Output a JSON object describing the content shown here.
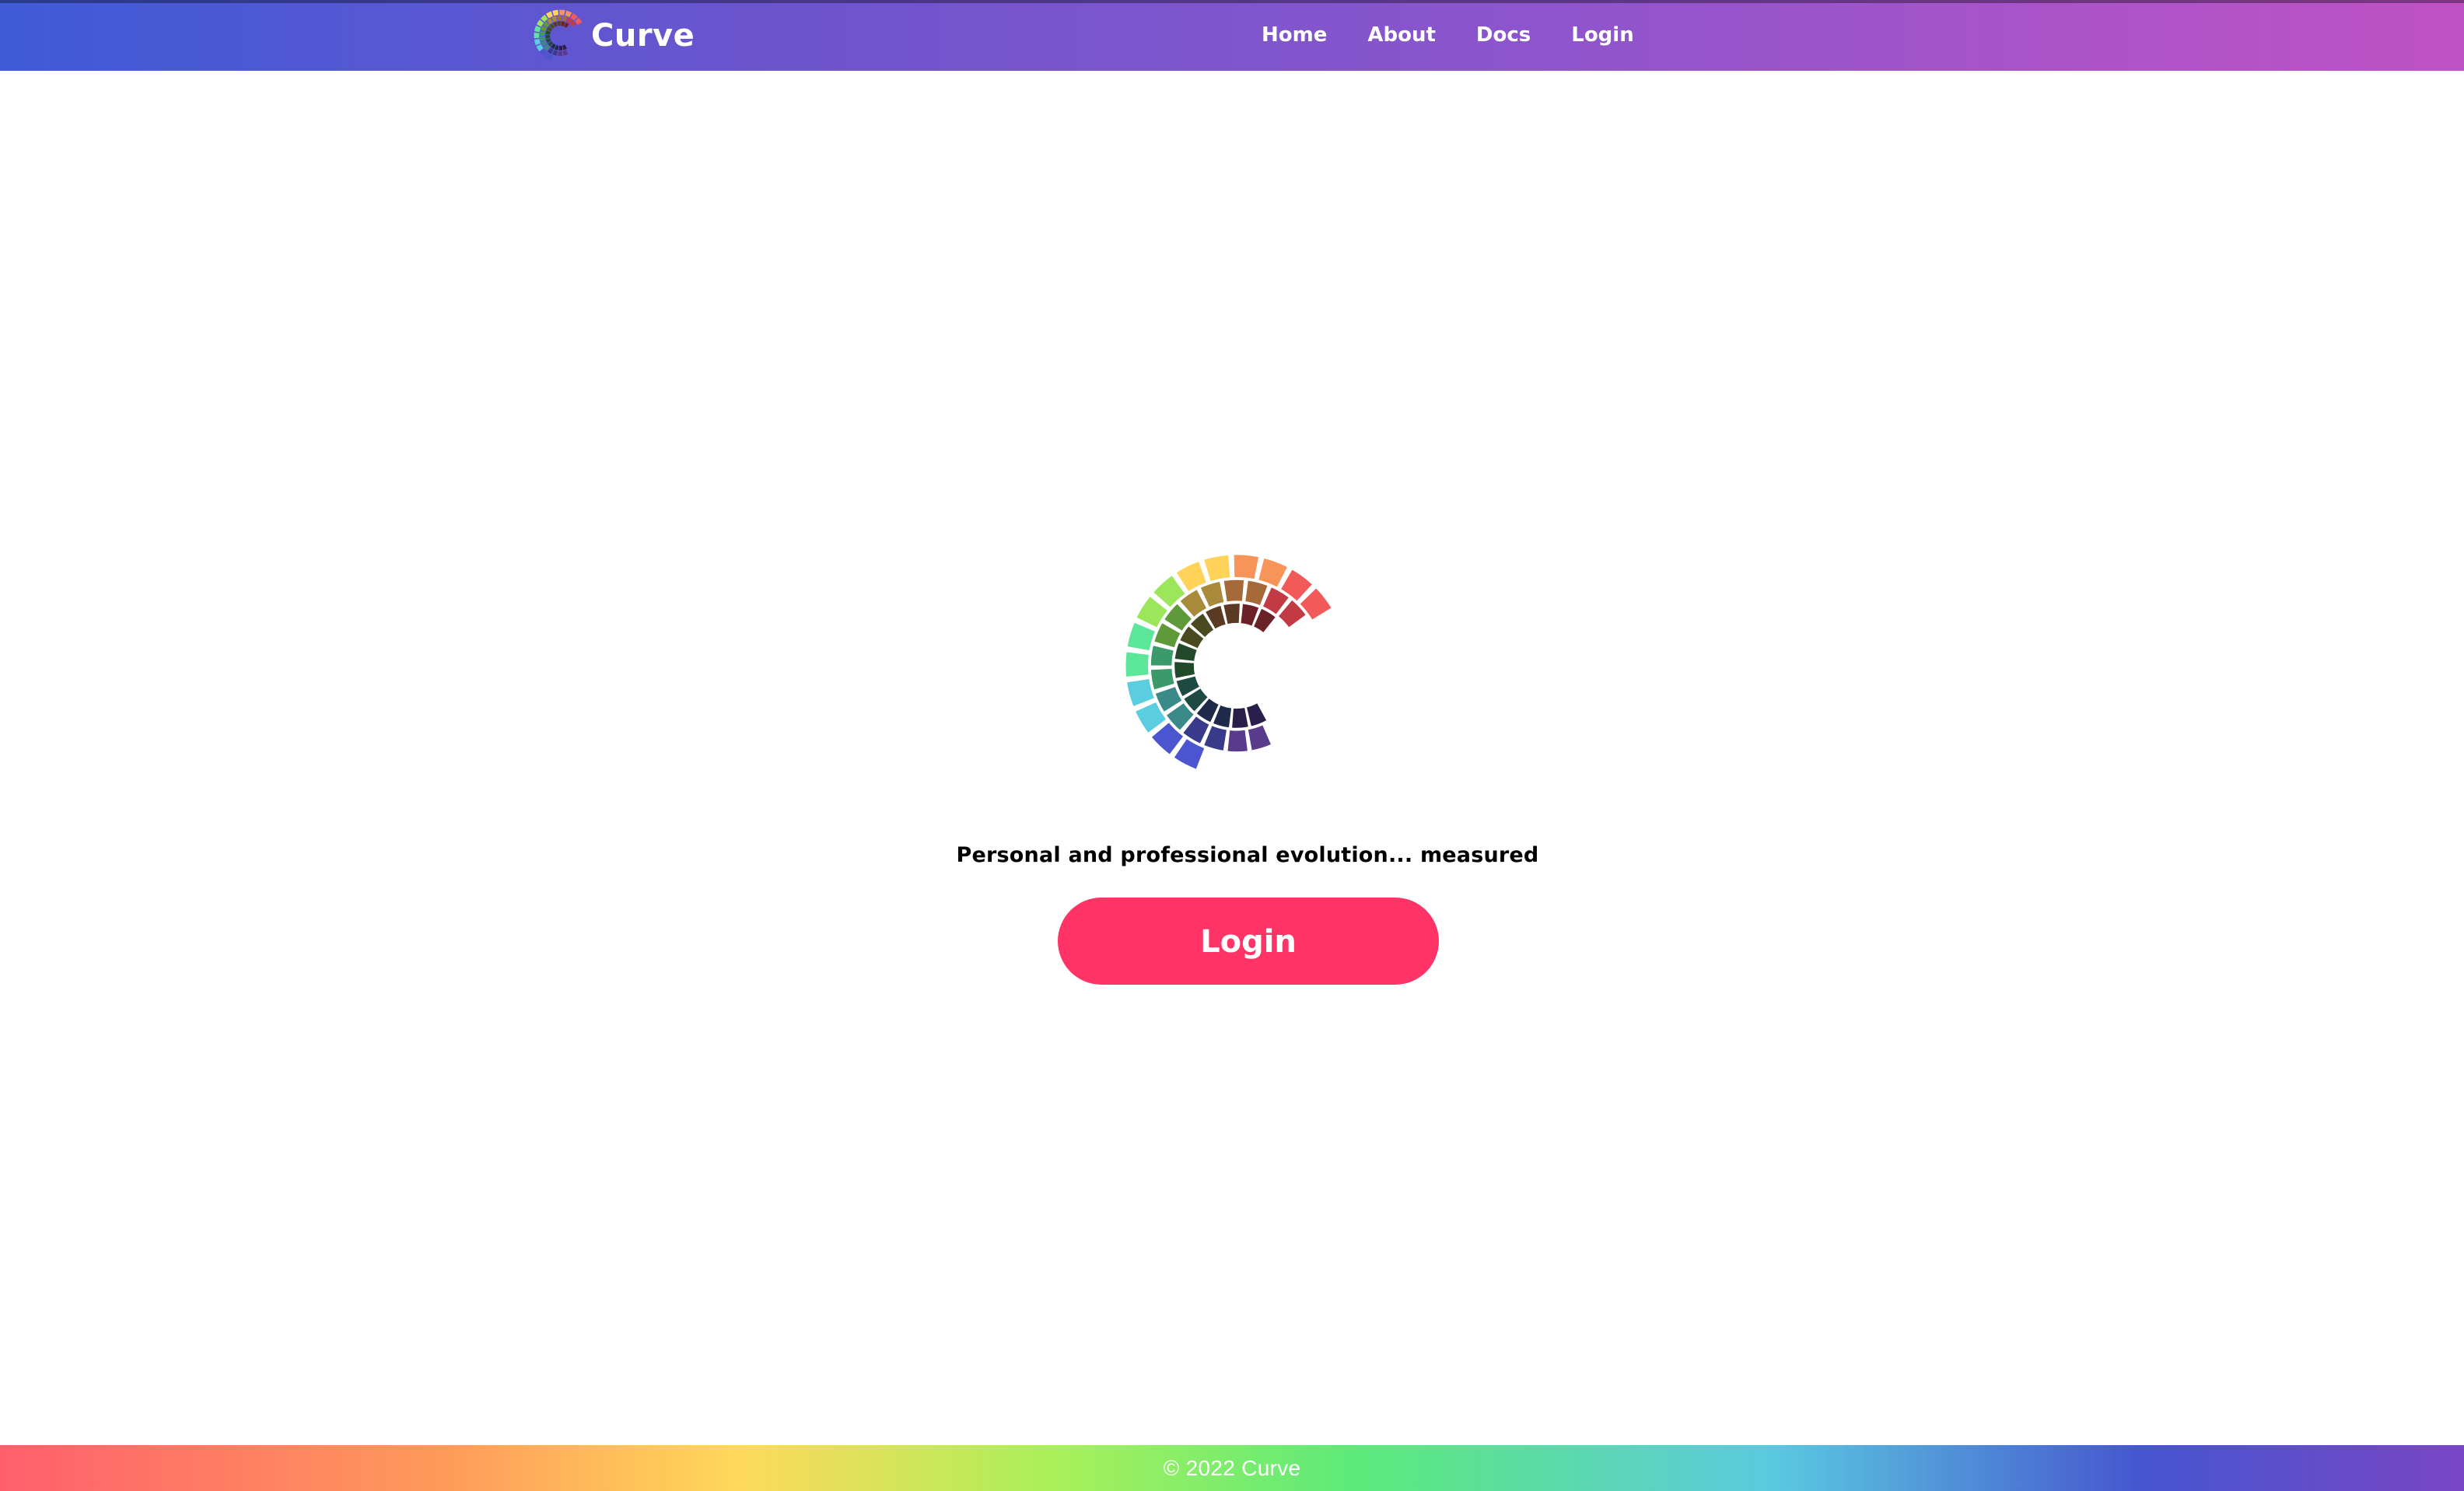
{
  "header": {
    "brand_name": "Curve",
    "nav": {
      "home": "Home",
      "about": "About",
      "docs": "Docs",
      "login": "Login"
    }
  },
  "hero": {
    "tagline": "Personal and professional evolution... measured",
    "login_button": "Login"
  },
  "footer": {
    "copyright": "© 2022 Curve"
  },
  "colors": {
    "header_gradient": [
      "#3f5bd6",
      "#c052c6"
    ],
    "login_button": "#ff3366",
    "footer_gradient": [
      "#ff5f6d",
      "#ffd95a",
      "#5cea7a",
      "#5ac9e0",
      "#4655cf",
      "#7a46c6"
    ],
    "logo_ring_outer": [
      "#f25a5a",
      "#f7945a",
      "#ffd25a",
      "#9be65a",
      "#5ce69a",
      "#5acde0",
      "#4b55cf"
    ],
    "logo_ring_middle": [
      "#c23a44",
      "#a66a3a",
      "#a88a3a",
      "#5e9a3a",
      "#3a9a6a",
      "#3a8a8a",
      "#3a3a8a",
      "#5a3a8a"
    ],
    "logo_ring_inner": [
      "#6a2228",
      "#5a3a22",
      "#4a4a22",
      "#224a2a",
      "#1f4a44",
      "#1f2a4a",
      "#2a1f4a"
    ]
  }
}
